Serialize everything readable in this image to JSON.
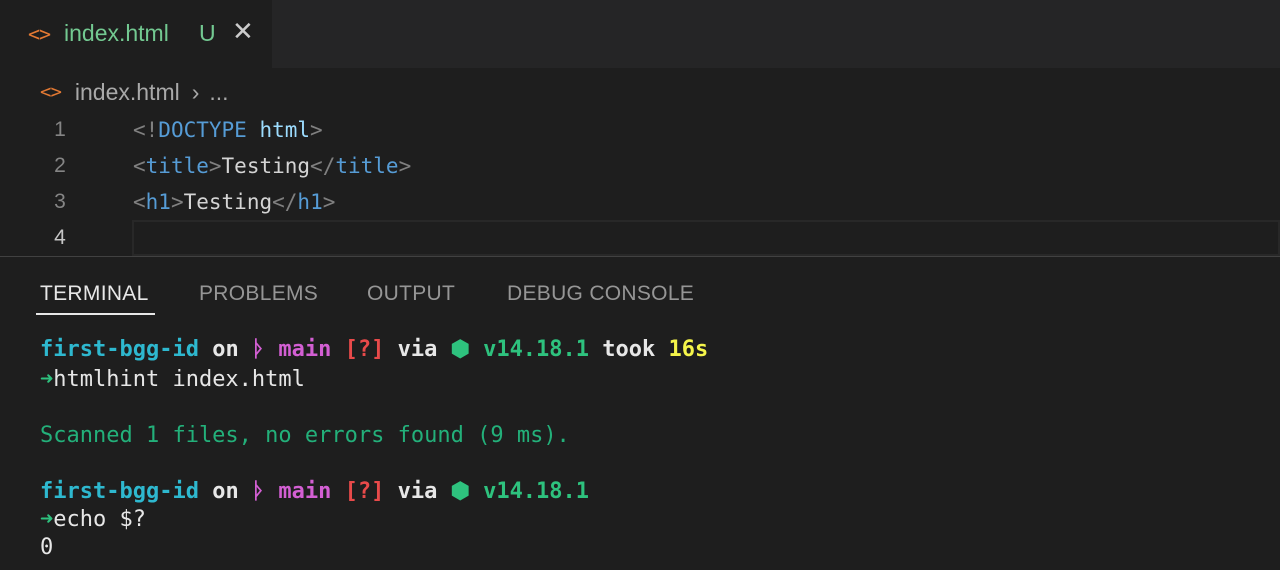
{
  "tab": {
    "icon": "html-file-icon",
    "name": "index.html",
    "badge": "U",
    "close": "✕"
  },
  "breadcrumb": {
    "file": "index.html",
    "separator": "›",
    "more": "..."
  },
  "editor": {
    "lines": [
      {
        "no": "1",
        "p1": "<!",
        "kw": "DOCTYPE",
        "sp": " ",
        "attr": "html",
        "p2": ">"
      },
      {
        "no": "2",
        "open_p": "<",
        "open_t": "title",
        "open_c": ">",
        "text": "Testing",
        "close_p": "</",
        "close_t": "title",
        "close_c": ">"
      },
      {
        "no": "3",
        "open_p": "<",
        "open_t": "h1",
        "open_c": ">",
        "text": "Testing",
        "close_p": "</",
        "close_t": "h1",
        "close_c": ">"
      },
      {
        "no": "4"
      }
    ]
  },
  "panel": {
    "tabs": [
      "TERMINAL",
      "PROBLEMS",
      "OUTPUT",
      "DEBUG CONSOLE"
    ]
  },
  "terminal": {
    "prompt1": {
      "dir": "first-bgg-id",
      "on": " on ",
      "git_icon": "ᚦ",
      "branch": " main ",
      "status": "[?]",
      "via": " via ",
      "node_icon": "⬢",
      "node": " v14.18.1",
      "took": " took ",
      "duration": "16s"
    },
    "cmd1": "htmlhint index.html",
    "output1": "Scanned 1 files, no errors found (9 ms).",
    "prompt2": {
      "dir": "first-bgg-id",
      "on": " on ",
      "git_icon": "ᚦ",
      "branch": " main ",
      "status": "[?]",
      "via": " via ",
      "node_icon": "⬢",
      "node": " v14.18.1"
    },
    "arrow": "➜",
    "cmd2": "echo $?",
    "output2": "0"
  },
  "colors": {
    "background": "#1e1e1e",
    "tab_modified": "#73c991",
    "html_icon": "#e37933",
    "tag": "#569cd6",
    "prompt_dir": "#2eb8cf",
    "git_branch": "#d35fd3",
    "node": "#2ec27e",
    "duration": "#f5f54a"
  }
}
